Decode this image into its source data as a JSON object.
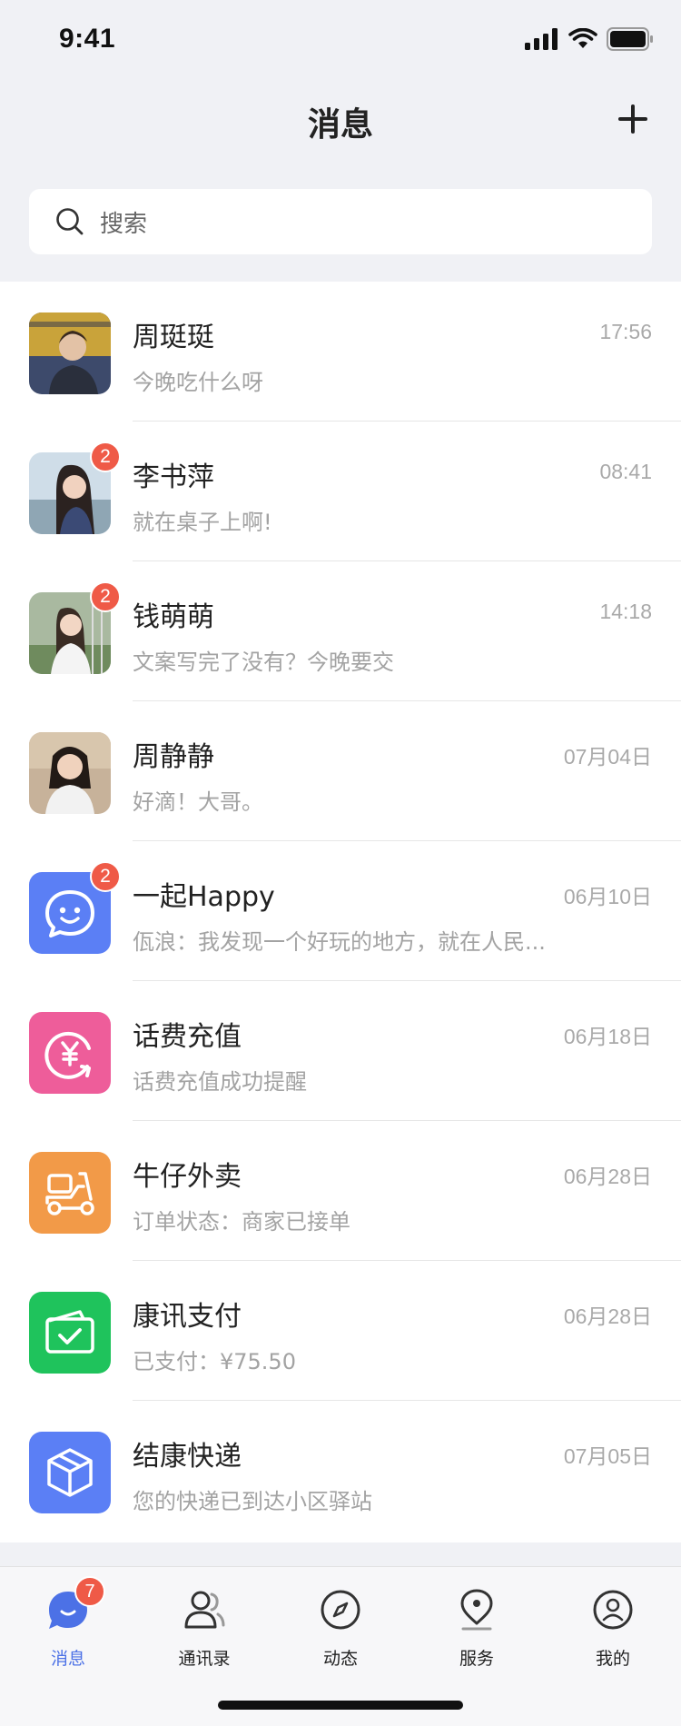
{
  "status_bar": {
    "time": "9:41"
  },
  "header": {
    "title": "消息",
    "add_icon": "plus-icon"
  },
  "search": {
    "placeholder": "搜索",
    "icon": "search-icon"
  },
  "chats": [
    {
      "name": "周珽珽",
      "time": "17:56",
      "preview": "今晚吃什么呀",
      "badge": "",
      "avatar_kind": "photo",
      "avatar_color": "#c9a33a"
    },
    {
      "name": "李书萍",
      "time": "08:41",
      "preview": "就在桌子上啊!",
      "badge": "2",
      "avatar_kind": "photo",
      "avatar_color": "#9fb6c8"
    },
    {
      "name": "钱萌萌",
      "time": "14:18",
      "preview": "文案写完了没有？今晚要交",
      "badge": "2",
      "avatar_kind": "photo",
      "avatar_color": "#8aa57a"
    },
    {
      "name": "周静静",
      "time": "07月04日",
      "preview": "好滴！大哥。",
      "badge": "",
      "avatar_kind": "photo",
      "avatar_color": "#b9a28a"
    },
    {
      "name": "一起Happy",
      "time": "06月10日",
      "preview": "佤浪：我发现一个好玩的地方，就在人民...",
      "badge": "2",
      "avatar_kind": "icon",
      "avatar_icon": "chat-smile-icon",
      "avatar_color": "#5b7ff5"
    },
    {
      "name": "话费充值",
      "time": "06月18日",
      "preview": "话费充值成功提醒",
      "badge": "",
      "avatar_kind": "icon",
      "avatar_icon": "yuan-recharge-icon",
      "avatar_color": "#ee5d9a"
    },
    {
      "name": "牛仔外卖",
      "time": "06月28日",
      "preview": "订单状态：商家已接单",
      "badge": "",
      "avatar_kind": "icon",
      "avatar_icon": "scooter-icon",
      "avatar_color": "#f29a48"
    },
    {
      "name": "康讯支付",
      "time": "06月28日",
      "preview": "已支付：¥75.50",
      "badge": "",
      "avatar_kind": "icon",
      "avatar_icon": "wallet-check-icon",
      "avatar_color": "#1fc35c"
    },
    {
      "name": "结康快递",
      "time": "07月05日",
      "preview": "您的快递已到达小区驿站",
      "badge": "",
      "avatar_kind": "icon",
      "avatar_icon": "package-icon",
      "avatar_color": "#5b7ff5"
    }
  ],
  "tabs": [
    {
      "label": "消息",
      "icon": "message-icon",
      "active": true,
      "badge": "7"
    },
    {
      "label": "通讯录",
      "icon": "contacts-icon",
      "active": false,
      "badge": ""
    },
    {
      "label": "动态",
      "icon": "compass-icon",
      "active": false,
      "badge": ""
    },
    {
      "label": "服务",
      "icon": "location-pin-icon",
      "active": false,
      "badge": ""
    },
    {
      "label": "我的",
      "icon": "profile-icon",
      "active": false,
      "badge": ""
    }
  ],
  "colors": {
    "accent": "#4c71e6",
    "badge": "#ef5a47",
    "background": "#f0f1f5"
  }
}
